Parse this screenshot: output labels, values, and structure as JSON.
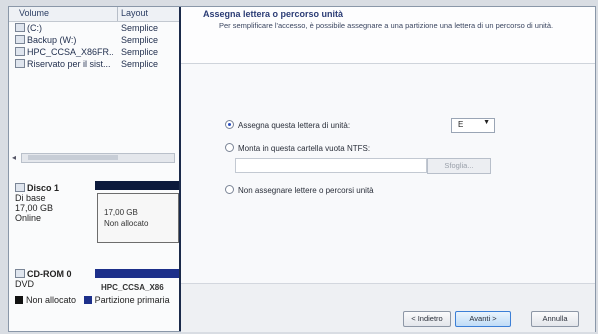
{
  "left_panel": {
    "columns": {
      "volume": "Volume",
      "layout": "Layout"
    },
    "volumes": [
      {
        "name": "(C:)",
        "layout": "Semplice"
      },
      {
        "name": "Backup (W:)",
        "layout": "Semplice"
      },
      {
        "name": "HPC_CCSA_X86FR...",
        "layout": "Semplice"
      },
      {
        "name": "Riservato per il sist...",
        "layout": "Semplice"
      }
    ],
    "disk1": {
      "title": "Disco 1",
      "type": "Di base",
      "size": "17,00 GB",
      "status": "Online",
      "partition_size": "17,00 GB",
      "partition_status": "Non allocato"
    },
    "cdrom": {
      "title": "CD-ROM 0",
      "type": "DVD",
      "partition_label": "HPC_CCSA_X86"
    },
    "legend": {
      "unallocated": "Non allocato",
      "primary": "Partizione primaria"
    }
  },
  "dialog": {
    "title": "Assegna lettera o percorso unità",
    "description": "Per semplificare l'accesso, è possibile assegnare a una partizione una lettera di un percorso di unità.",
    "option_assign": "Assegna questa lettera di unità:",
    "drive_letter": "E",
    "option_mount": "Monta in questa cartella vuota NTFS:",
    "browse_label": "Sfoglia...",
    "option_none": "Non assegnare lettere o percorsi unità",
    "buttons": {
      "back": "< Indietro",
      "next": "Avanti >",
      "cancel": "Annulla"
    }
  }
}
